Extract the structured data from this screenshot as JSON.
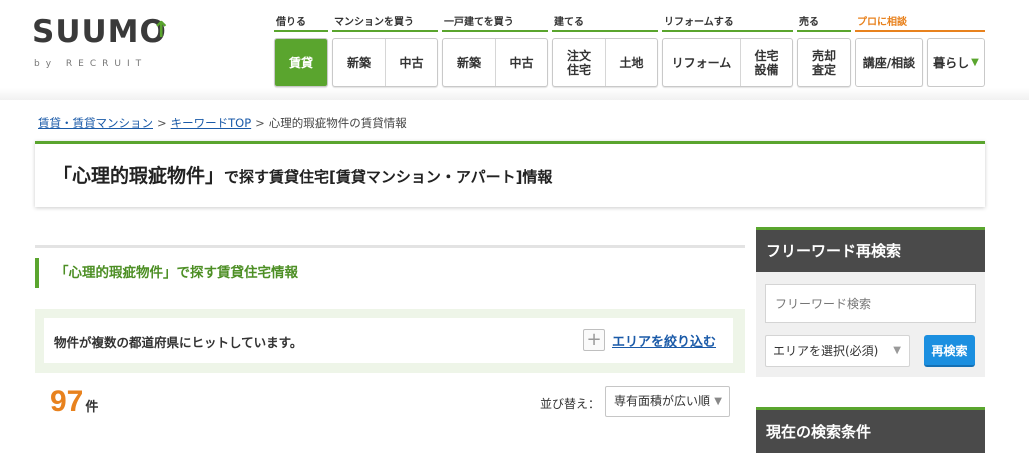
{
  "header": {
    "logo_text": "SUUMO",
    "logo_sub": "by RECRUIT",
    "nav": [
      {
        "category": "借りる",
        "buttons": [
          "賃貸"
        ]
      },
      {
        "category": "マンションを買う",
        "buttons": [
          "新築",
          "中古"
        ]
      },
      {
        "category": "一戸建てを買う",
        "buttons": [
          "新築",
          "中古"
        ]
      },
      {
        "category": "建てる",
        "buttons": [
          "注文\n住宅",
          "土地"
        ]
      },
      {
        "category": "リフォームする",
        "buttons": [
          "リフォーム",
          "住宅\n設備"
        ]
      },
      {
        "category": "売る",
        "buttons": [
          "売却\n査定"
        ]
      },
      {
        "category": "プロに相談",
        "buttons": [
          "講座/相談",
          "暮らし"
        ]
      }
    ]
  },
  "breadcrumb": {
    "item1": "賃貸・賃貸マンション",
    "item2": "キーワードTOP",
    "current": "心理的瑕疵物件の賃貸情報",
    "separator": ">"
  },
  "title": {
    "keyword": "「心理的瑕疵物件」",
    "rest": "で探す賃貸住宅[賃貸マンション・アパート]情報"
  },
  "section": {
    "heading": "「心理的瑕疵物件」で探す賃貸住宅情報"
  },
  "notice": {
    "text": "物件が複数の都道府県にヒットしています。",
    "narrow_label": "エリアを絞り込む"
  },
  "results": {
    "count": "97",
    "unit": "件",
    "sort_label": "並び替え：",
    "sort_value": "専有面積が広い順"
  },
  "sidebar": {
    "freeword_title": "フリーワード再検索",
    "freeword_placeholder": "フリーワード検索",
    "area_select": "エリアを選択(必須)",
    "research_button": "再検索",
    "conditions_title": "現在の検索条件"
  },
  "colors": {
    "brand_green": "#5aa52e",
    "link_blue": "#1a5aa8",
    "count_orange": "#e8821e",
    "button_blue": "#1b8fe0",
    "sidebar_head": "#4a4a4a"
  }
}
